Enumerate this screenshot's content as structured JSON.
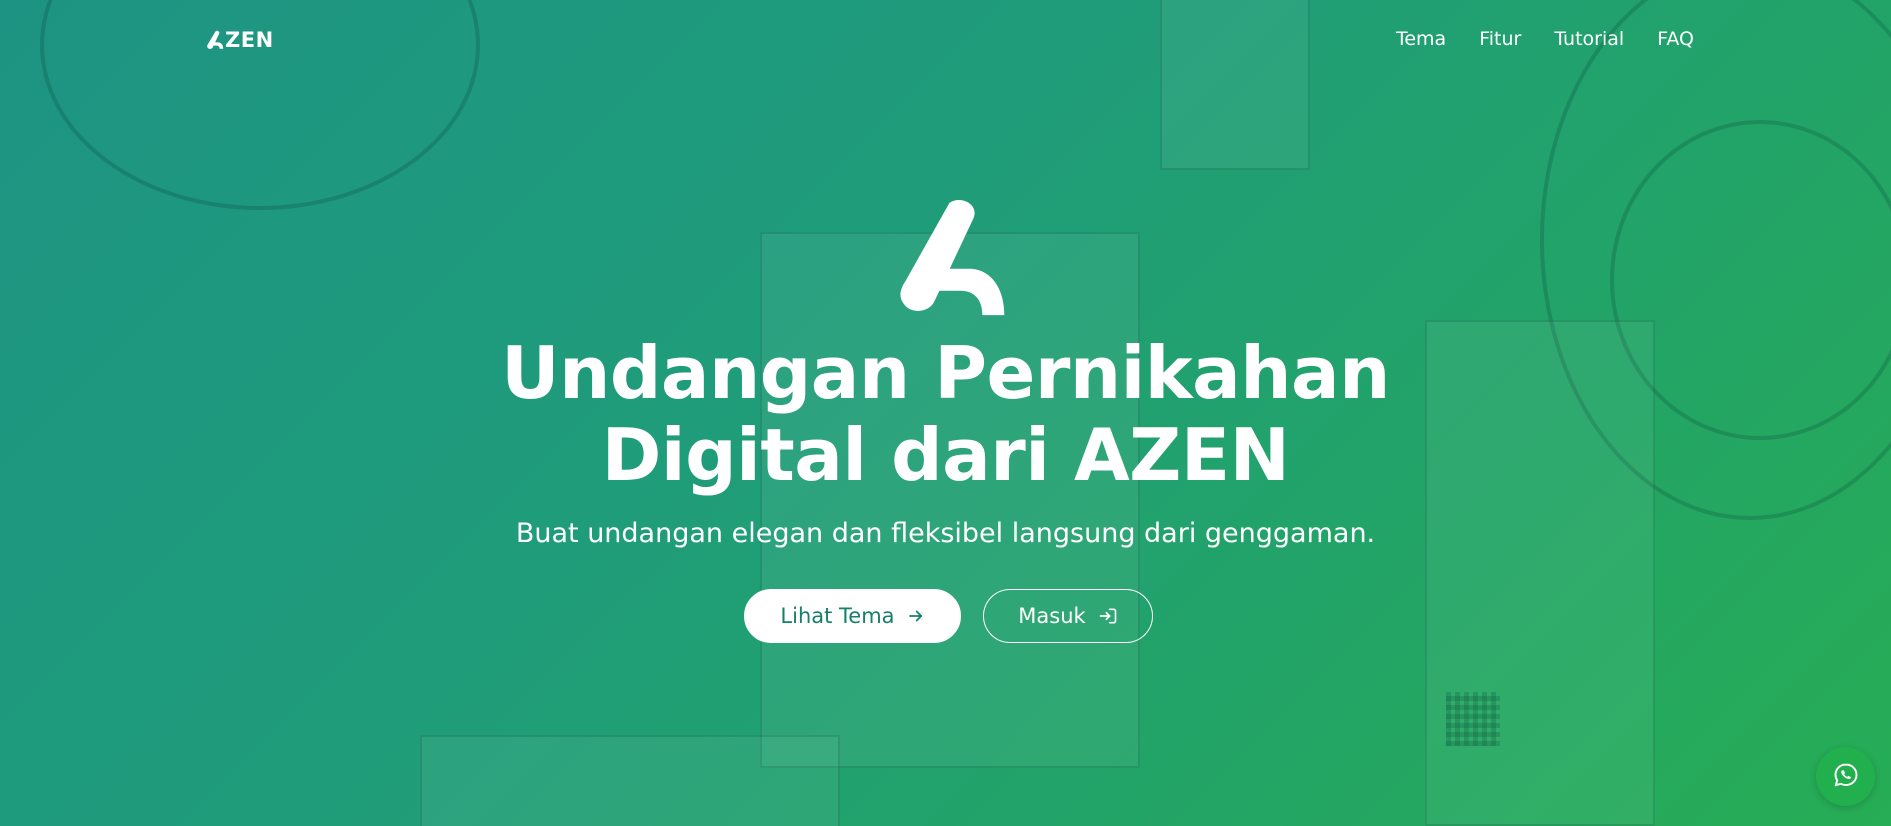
{
  "brand": {
    "logo_text": "ZEN",
    "logo_icon": "azen-a-logo-icon"
  },
  "nav": {
    "items": [
      {
        "label": "Tema"
      },
      {
        "label": "Fitur"
      },
      {
        "label": "Tutorial"
      },
      {
        "label": "FAQ"
      }
    ]
  },
  "hero": {
    "brand_mark_icon": "azen-a-logo-icon",
    "title_line1": "Undangan Pernikahan",
    "title_line2": "Digital dari AZEN",
    "subtitle": "Buat undangan elegan dan fleksibel langsung dari genggaman.",
    "primary_button": {
      "label": "Lihat Tema",
      "icon": "arrow-right-icon"
    },
    "secondary_button": {
      "label": "Masuk",
      "icon": "login-icon"
    }
  },
  "floating": {
    "whatsapp_icon": "whatsapp-icon"
  },
  "colors": {
    "gradient_start": "#1d9483",
    "gradient_end": "#27ad55",
    "primary_button_text": "#17806a",
    "whatsapp": "#22b04f"
  }
}
